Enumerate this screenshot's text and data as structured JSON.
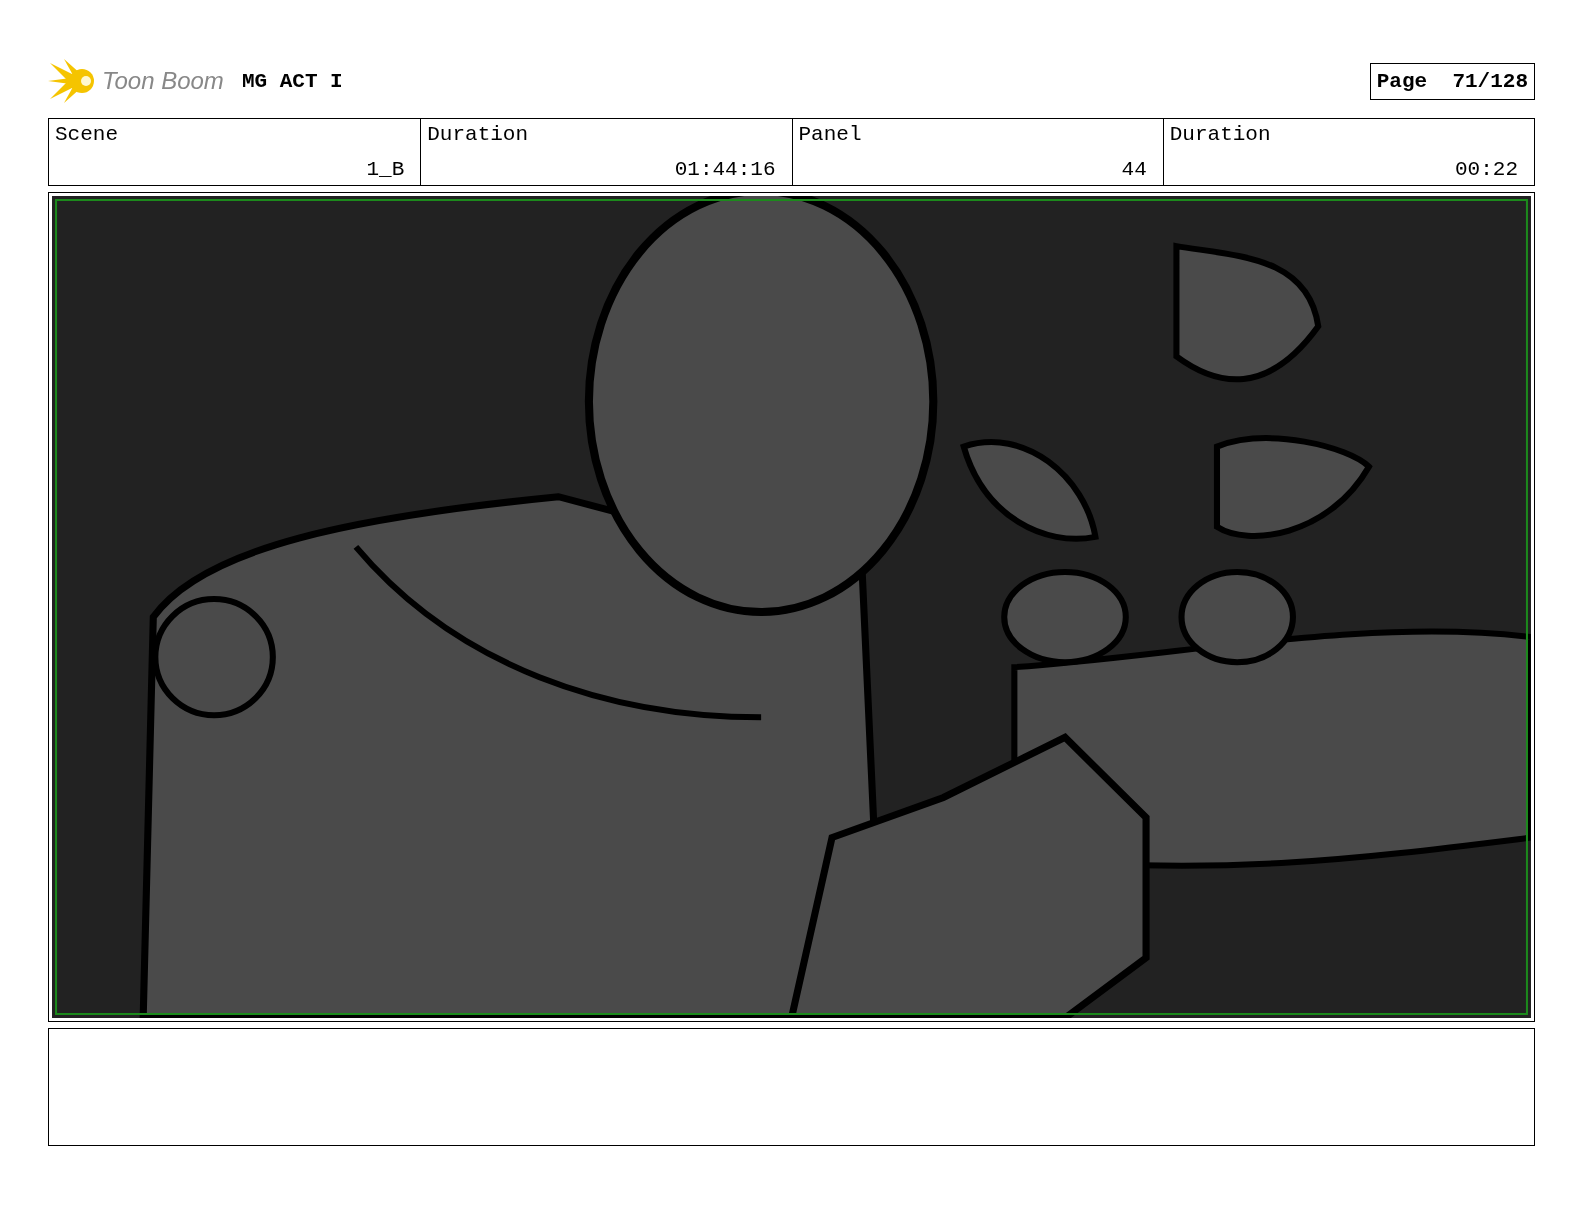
{
  "header": {
    "logo": "Toon Boom",
    "project": "MG ACT I",
    "page": "Page  71/128"
  },
  "fields": [
    {
      "label": "Scene",
      "value": "1_B"
    },
    {
      "label": "Duration",
      "value": "01:44:16"
    },
    {
      "label": "Panel",
      "value": "44"
    },
    {
      "label": "Duration",
      "value": "00:22"
    }
  ]
}
